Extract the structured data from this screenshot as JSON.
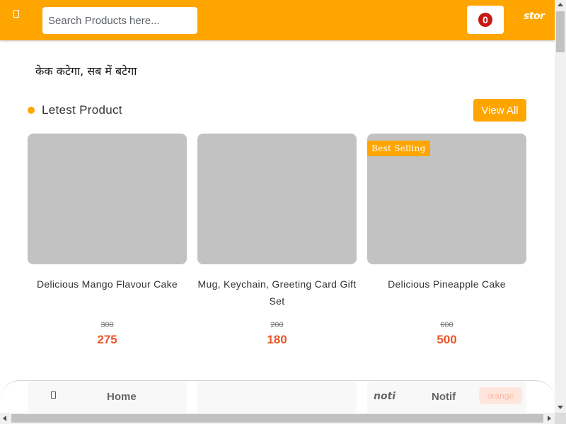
{
  "header": {
    "search_placeholder": "Search Products here...",
    "cart_count": "0",
    "brand": "stor"
  },
  "tagline": "केक कटेगा, सब में बटेगा",
  "section": {
    "title": "Letest Product",
    "view_all": "View All"
  },
  "products": [
    {
      "name": "Delicious Mango Flavour Cake",
      "old_price": "300",
      "price": "275",
      "badge": ""
    },
    {
      "name": "Mug, Keychain, Greeting Card Gift Set",
      "old_price": "200",
      "price": "180",
      "badge": ""
    },
    {
      "name": "Delicious Pineapple Cake",
      "old_price": "600",
      "price": "500",
      "badge": "Best Selling"
    }
  ],
  "bottom_nav": {
    "home": "Home",
    "noti": "noti",
    "notif": "Notif",
    "orange": "orange"
  },
  "colors": {
    "primary": "#ffa500",
    "price": "#e8572a",
    "cart_badge": "#c41a14",
    "placeholder_image": "#c2c2c2"
  },
  "icons": {
    "menu": "menu-icon",
    "home": "home-icon",
    "cart": "cart-icon"
  }
}
